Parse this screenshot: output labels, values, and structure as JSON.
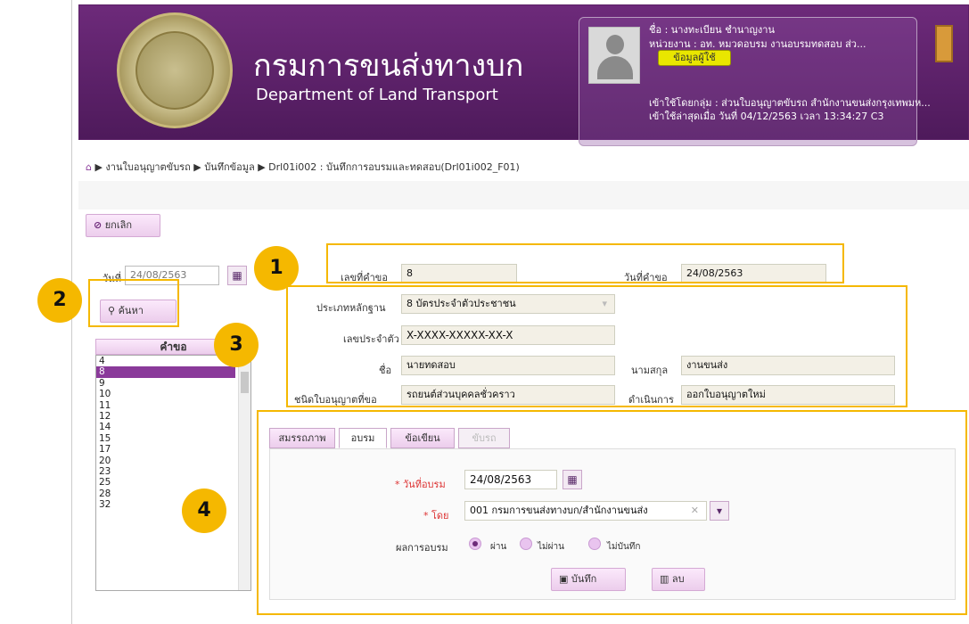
{
  "header": {
    "brand_th": "กรมการขนส่งทางบก",
    "brand_en": "Department of Land Transport",
    "user_name": "ชื่อ : นางทะเบียน ชำนาญงาน",
    "user_unit": "หน่วยงาน : อท. หมวดอบรม งานอบรมทดสอบ ส่ว...",
    "user_info_button": "ข้อมูลผู้ใช้",
    "user_group": "เข้าใช้โดยกลุ่ม : ส่วนใบอนุญาตขับรถ สำนักงานขนส่งกรุงเทพมห...",
    "last_login": "เข้าใช้ล่าสุดเมื่อ วันที่ 04/12/2563 เวลา 13:34:27 C3"
  },
  "breadcrumb": {
    "text": "▶ งานใบอนุญาตขับรถ ▶ บันทึกข้อมูล ▶ Drl01i002 : บันทึกการอบรมและทดสอบ(Drl01i002_F01)"
  },
  "toolbar": {
    "cancel_label": "ยกเลิก"
  },
  "search": {
    "date_label": "วันที่",
    "date_value": "24/08/2563",
    "search_label": "ค้นหา"
  },
  "request_list": {
    "header": "คำขอ",
    "items": [
      "4",
      "8",
      "9",
      "10",
      "11",
      "12",
      "14",
      "15",
      "17",
      "20",
      "23",
      "25",
      "28",
      "32"
    ],
    "selected": "8"
  },
  "request_info": {
    "req_no_label": "เลขที่คำขอ",
    "req_no_value": "8",
    "req_date_label": "วันที่คำขอ",
    "req_date_value": "24/08/2563"
  },
  "applicant": {
    "evidence_type_label": "ประเภทหลักฐาน",
    "evidence_type_value": "8 บัตรประจำตัวประชาชน",
    "id_label": "เลขประจำตัว",
    "id_value": "X-XXXX-XXXXX-XX-X",
    "first_name_label": "ชื่อ",
    "first_name_value": "นายทดสอบ",
    "last_name_label": "นามสกุล",
    "last_name_value": "งานขนส่ง",
    "license_type_label": "ชนิดใบอนุญาตที่ขอ",
    "license_type_value": "รถยนต์ส่วนบุคคลชั่วคราว",
    "action_label": "ดำเนินการ",
    "action_value": "ออกใบอนุญาตใหม่"
  },
  "tabs": [
    "สมรรถภาพ",
    "อบรม",
    "ข้อเขียน",
    "ขับรถ"
  ],
  "training": {
    "date_label": "วันที่อบรม",
    "date_value": "24/08/2563",
    "by_label": "โดย",
    "by_value": "001 กรมการขนส่งทางบก/สำนักงานขนส่ง",
    "result_label": "ผลการอบรม",
    "result_options": [
      "ผ่าน",
      "ไม่ผ่าน",
      "ไม่บันทึก"
    ],
    "save_label": "บันทึก",
    "delete_label": "ลบ",
    "required_mark": "*"
  },
  "callouts": [
    "1",
    "2",
    "3",
    "4"
  ]
}
